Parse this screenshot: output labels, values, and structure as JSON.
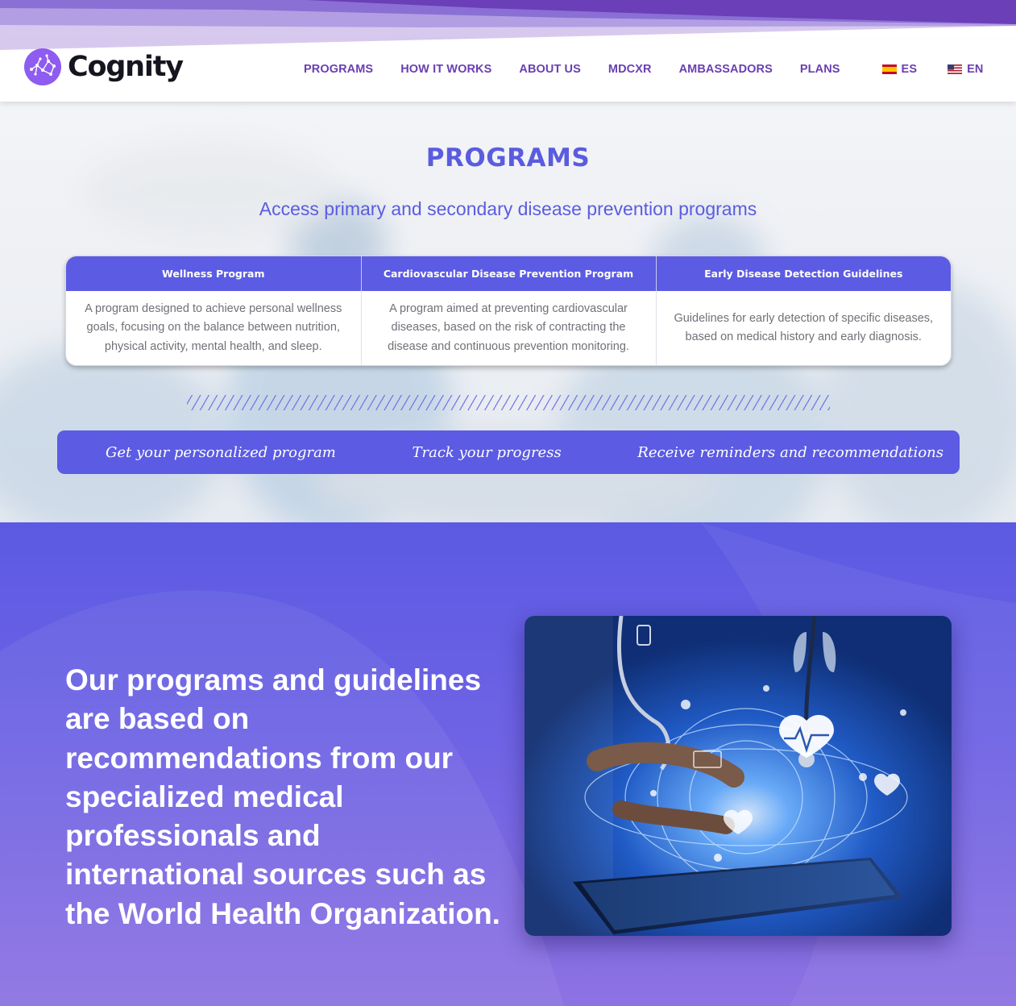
{
  "brand": {
    "name": "Cognity",
    "colors": {
      "primary": "#5b5be3",
      "nav": "#6a3fb1",
      "logo": "#8e5cf0"
    }
  },
  "nav": {
    "items": [
      {
        "label": "PROGRAMS"
      },
      {
        "label": "HOW IT WORKS"
      },
      {
        "label": "ABOUT US"
      },
      {
        "label": "MDCXR"
      },
      {
        "label": "AMBASSADORS"
      },
      {
        "label": "PLANS"
      }
    ],
    "languages": [
      {
        "label": "ES",
        "flag": "spain-flag-icon"
      },
      {
        "label": "EN",
        "flag": "us-flag-icon"
      }
    ]
  },
  "programs": {
    "title": "PROGRAMS",
    "subtitle": "Access primary and secondary disease prevention programs",
    "table": {
      "headers": [
        "Wellness Program",
        "Cardiovascular Disease Prevention Program",
        "Early Disease Detection Guidelines"
      ],
      "cells": [
        "A program designed to achieve personal wellness goals, focusing on the balance between nutrition, physical activity, mental health, and sleep.",
        "A program aimed at preventing cardiovascular diseases, based on the risk of contracting the disease and continuous prevention monitoring.",
        "Guidelines for early detection of specific diseases, based on medical history and early diagnosis."
      ]
    },
    "steps": [
      "Get your personalized program",
      "Track your progress",
      "Receive reminders and recommendations"
    ]
  },
  "info": {
    "text": "Our programs and guidelines are based on recommendations from our specialized medical professionals and international sources such as the World Health Organization.",
    "image": "doctor-with-digital-health-tablet-image"
  }
}
